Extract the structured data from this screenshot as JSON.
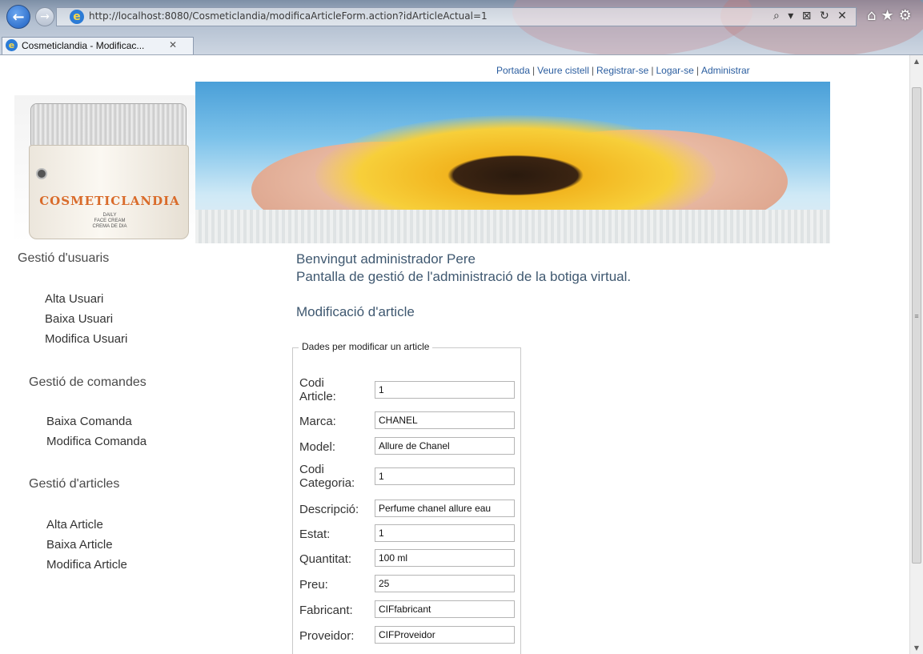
{
  "browser": {
    "url": "http://localhost:8080/Cosmeticlandia/modificaArticleForm.action?idArticleActual=1",
    "address_controls": "⌕ ▾ ⊠ ↻ ✕",
    "tab_title": "Cosmeticlandia - Modificac...",
    "tab_close": "✕",
    "icons": [
      "back-arrow-icon",
      "forward-arrow-icon",
      "ie-logo-icon",
      "home-icon",
      "favorites-star-icon",
      "settings-gear-icon"
    ]
  },
  "top_nav": {
    "items": [
      "Portada",
      "Veure cistell",
      "Registrar-se",
      "Logar-se",
      "Administrar"
    ],
    "separator": "|"
  },
  "logo": {
    "brand": "COSMETICLANDIA",
    "small_text_1": "DAILY",
    "small_text_2": "FACE CREAM",
    "small_text_3": "CREMA DE DIA"
  },
  "sidebar": {
    "groups": [
      {
        "title": "Gestió d'usuaris",
        "links": [
          "Alta Usuari",
          "Baixa Usuari",
          "Modifica Usuari"
        ]
      },
      {
        "title": "Gestió de comandes",
        "links": [
          "Baixa Comanda",
          "Modifica Comanda"
        ]
      },
      {
        "title": "Gestió d'articles",
        "links": [
          "Alta Article",
          "Baixa Article",
          "Modifica Article"
        ]
      }
    ]
  },
  "main": {
    "welcome_line_1": "Benvingut administrador Pere",
    "welcome_line_2": "Pantalla de gestió de l'administració de la botiga virtual.",
    "section_title": "Modificació d'article",
    "form_legend": "Dades per modificar un article",
    "fields": [
      {
        "label_1": "Codi",
        "label_2": "Article:",
        "value": "1"
      },
      {
        "label_1": "Marca:",
        "label_2": "",
        "value": "CHANEL"
      },
      {
        "label_1": "Model:",
        "label_2": "",
        "value": "Allure de Chanel"
      },
      {
        "label_1": "Codi",
        "label_2": "Categoria:",
        "value": "1"
      },
      {
        "label_1": "Descripció:",
        "label_2": "",
        "value": "Perfume chanel allure eau"
      },
      {
        "label_1": "Estat:",
        "label_2": "",
        "value": "1"
      },
      {
        "label_1": "Quantitat:",
        "label_2": "",
        "value": "100 ml"
      },
      {
        "label_1": "Preu:",
        "label_2": "",
        "value": "25"
      },
      {
        "label_1": "Fabricant:",
        "label_2": "",
        "value": "CIFfabricant"
      },
      {
        "label_1": "Proveidor:",
        "label_2": "",
        "value": "CIFProveidor"
      }
    ]
  }
}
